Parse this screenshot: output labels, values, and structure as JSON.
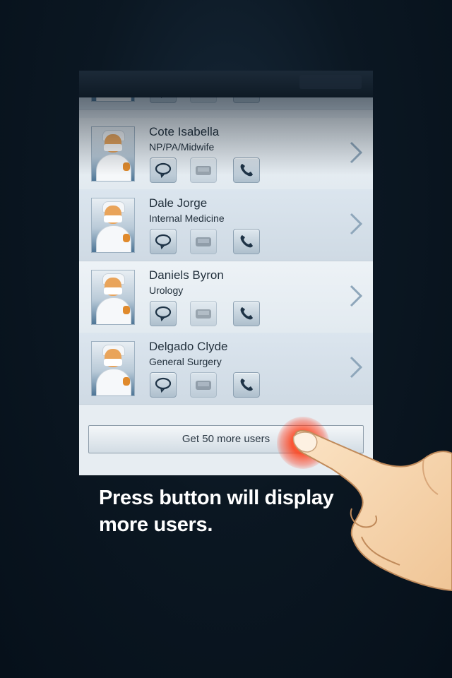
{
  "app": {
    "header_title": "",
    "list_items": [
      {
        "name": "",
        "specialty": ""
      },
      {
        "name": "Cote Isabella",
        "specialty": "NP/PA/Midwife"
      },
      {
        "name": "Dale Jorge",
        "specialty": "Internal Medicine"
      },
      {
        "name": "Daniels Byron",
        "specialty": "Urology"
      },
      {
        "name": "Delgado Clyde",
        "specialty": "General Surgery"
      }
    ],
    "more_button_label": "Get 50 more users"
  },
  "tutorial": {
    "caption": "Press button will display more users."
  },
  "icons": {
    "row_actions": [
      "chat-bubble-icon",
      "pager-icon",
      "phone-icon"
    ],
    "row_accessory": "chevron-right-icon",
    "avatar": "surgeon-avatar-icon",
    "pointer": "pointing-hand-icon"
  },
  "colors": {
    "background": "#0b1722",
    "list_background": "#e4ebf1",
    "touch_glow": "#ff4a1c",
    "caption_text": "#ffffff"
  }
}
